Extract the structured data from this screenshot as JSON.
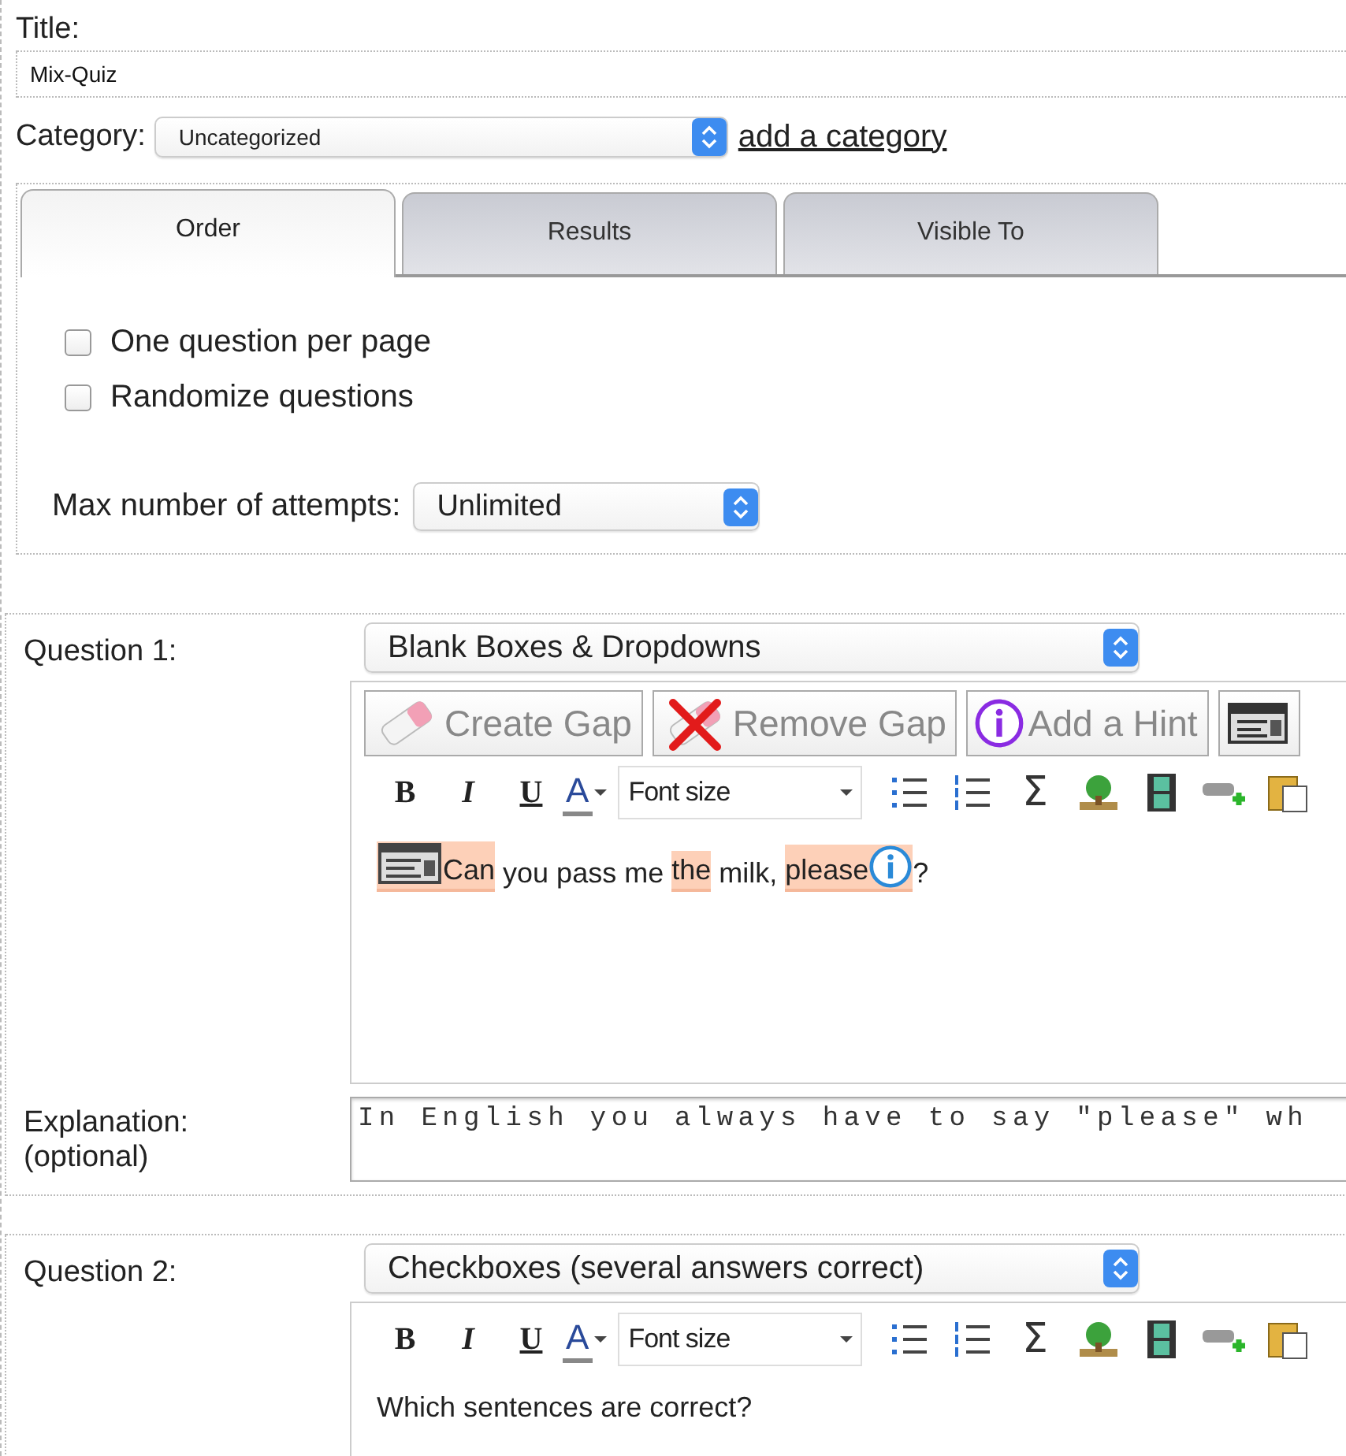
{
  "title_field": {
    "label": "Title:",
    "value": "Mix-Quiz"
  },
  "category": {
    "label": "Category:",
    "value": "Uncategorized",
    "link": "add a category"
  },
  "tabs": [
    {
      "label": "Order",
      "selected": true
    },
    {
      "label": "Results",
      "selected": false
    },
    {
      "label": "Visible To",
      "selected": false
    }
  ],
  "options": [
    {
      "label": "One question per page",
      "checked": false
    },
    {
      "label": "Randomize questions",
      "checked": false
    }
  ],
  "attempts": {
    "label": "Max number of attempts:",
    "value": "Unlimited"
  },
  "questions": [
    {
      "label": "Question 1:",
      "type": "Blank Boxes & Dropdowns",
      "gap_buttons": [
        {
          "kind": "create",
          "label": "Create Gap"
        },
        {
          "kind": "remove",
          "label": "Remove Gap"
        },
        {
          "kind": "hint",
          "label": "Add a Hint"
        },
        {
          "kind": "form"
        }
      ],
      "format": {
        "bold": "B",
        "italic": "I",
        "underline": "U",
        "text_color": "A",
        "font_size": "Font size",
        "sigma": "Σ"
      },
      "content": [
        {
          "kind": "gap",
          "text": "Can",
          "dropdown": true,
          "hint": false
        },
        {
          "kind": "text",
          "text": " you pass me "
        },
        {
          "kind": "gap",
          "text": "the",
          "dropdown": false,
          "hint": false
        },
        {
          "kind": "text",
          "text": " milk, "
        },
        {
          "kind": "gap",
          "text": "please",
          "dropdown": false,
          "hint": true
        },
        {
          "kind": "text",
          "text": "?"
        }
      ],
      "explanation": {
        "label": "Explanation:",
        "sublabel": "(optional)",
        "value": "In English you always have to say \"please\" wh"
      }
    },
    {
      "label": "Question 2:",
      "type": "Checkboxes (several answers correct)",
      "format": {
        "bold": "B",
        "italic": "I",
        "underline": "U",
        "text_color": "A",
        "font_size": "Font size",
        "sigma": "Σ"
      },
      "content": [
        {
          "kind": "text",
          "text": "Which sentences are correct?"
        }
      ]
    }
  ]
}
